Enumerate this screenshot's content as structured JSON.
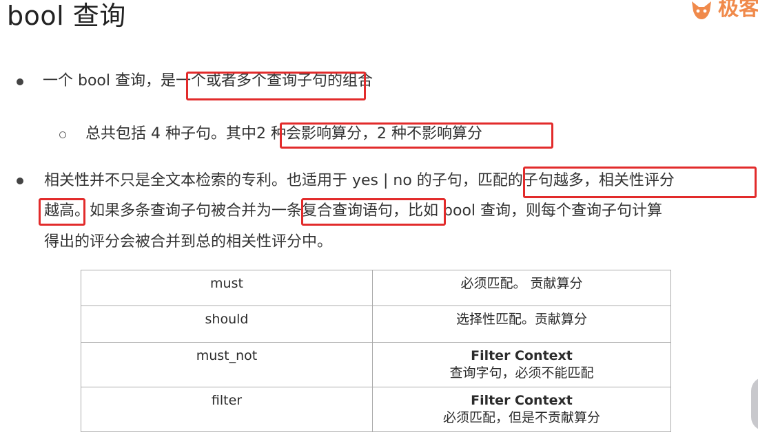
{
  "slide": {
    "title": "bool 查询",
    "logo_text": "极客",
    "bullets": [
      {
        "segments": [
          "一个 bool 查询，是",
          "一个或者多个查询子句",
          "的组合"
        ]
      },
      {
        "segments": [
          "总共包括 4 种子句。其中",
          "2 种会影响算分，2 种不影响算分"
        ]
      },
      {
        "line1": [
          "相关性并不只是全文本检索的专利。也适用于 yes | no 的子句，",
          "匹配的子句越多，相关性评分"
        ],
        "line2": [
          "越高",
          "。如果多条查询子句被合并为",
          "一条复合查询语句",
          "，比如 bool 查询，则每个查询子句计算"
        ],
        "line3": "得出的评分会被合并到总的相关性评分中。"
      }
    ]
  },
  "table": {
    "rows": [
      {
        "clause": "must",
        "desc_bold": "",
        "desc": "必须匹配。 贡献算分"
      },
      {
        "clause": "should",
        "desc_bold": "",
        "desc": "选择性匹配。贡献算分"
      },
      {
        "clause": "must_not",
        "desc_bold": "Filter Context",
        "desc": "查询字句，必须不能匹配"
      },
      {
        "clause": "filter",
        "desc_bold": "Filter Context",
        "desc": "必须匹配，但是不贡献算分"
      }
    ]
  },
  "colors": {
    "highlight": "#e22b2b",
    "logo": "#f08a4b"
  }
}
